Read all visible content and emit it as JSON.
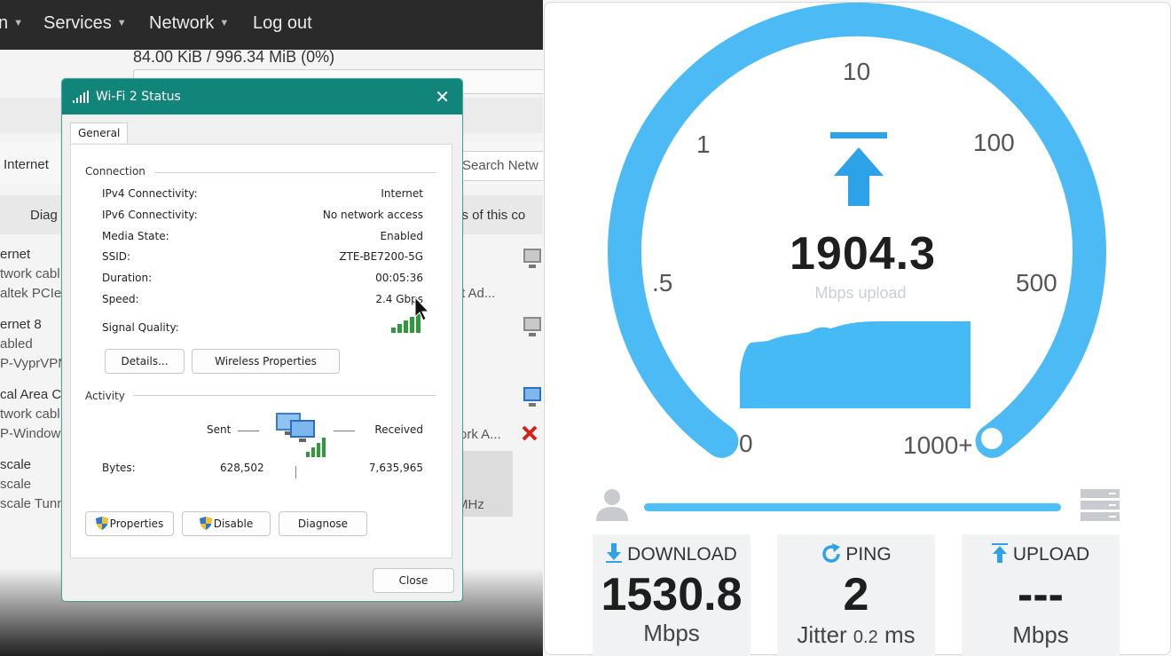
{
  "router": {
    "nav": [
      "n",
      "Services",
      "Network",
      "Log out"
    ],
    "usage": "84.00 KiB / 996.34 MiB (0%)",
    "left_fragments": {
      "internet_tab": "Internet",
      "diag": "Diag",
      "search": "Search Netw",
      "status": "tus of this co",
      "net1_name": "ernet",
      "net1_status": "twork cabl",
      "net1_dev": "altek PCIe",
      "net2_name": "ernet 8",
      "net2_status": "abled",
      "net2_dev": "P-VyprVPN",
      "net3_name": "cal Area Co",
      "net3_status": "twork cabl",
      "net3_dev": "P-Window",
      "net4_name": "scale",
      "net4_status": "scale",
      "net4_dev": "scale Tunn",
      "right1": "rt Ad...",
      "right2": "ork A...",
      "right3": "MHz"
    }
  },
  "dialog": {
    "title": "Wi-Fi 2 Status",
    "tab": "General",
    "connection_header": "Connection",
    "fields": [
      {
        "label": "IPv4 Connectivity:",
        "value": "Internet"
      },
      {
        "label": "IPv6 Connectivity:",
        "value": "No network access"
      },
      {
        "label": "Media State:",
        "value": "Enabled"
      },
      {
        "label": "SSID:",
        "value": "ZTE-BE7200-5G"
      },
      {
        "label": "Duration:",
        "value": "00:05:36"
      },
      {
        "label": "Speed:",
        "value": "2.4 Gbps"
      }
    ],
    "signal_quality_label": "Signal Quality:",
    "details_button": "Details...",
    "wireless_button": "Wireless Properties",
    "activity_header": "Activity",
    "sent_label": "Sent",
    "received_label": "Received",
    "bytes_label": "Bytes:",
    "bytes_sent": "628,502",
    "bytes_received": "7,635,965",
    "properties_button": "Properties",
    "disable_button": "Disable",
    "diagnose_button": "Diagnose",
    "close_button": "Close"
  },
  "speedtest": {
    "gauge_ticks": [
      "0",
      ".5",
      "1",
      "10",
      "100",
      "500",
      "1000+"
    ],
    "current_value": "1904.3",
    "current_unit": "Mbps upload",
    "download_label": "DOWNLOAD",
    "download_value": "1530.8",
    "download_unit": "Mbps",
    "ping_label": "PING",
    "ping_value": "2",
    "jitter_label": "Jitter",
    "jitter_value": "0.2",
    "jitter_unit": "ms",
    "upload_label": "UPLOAD",
    "upload_value": "---",
    "upload_unit": "Mbps",
    "accent_color": "#4cc0f7"
  }
}
